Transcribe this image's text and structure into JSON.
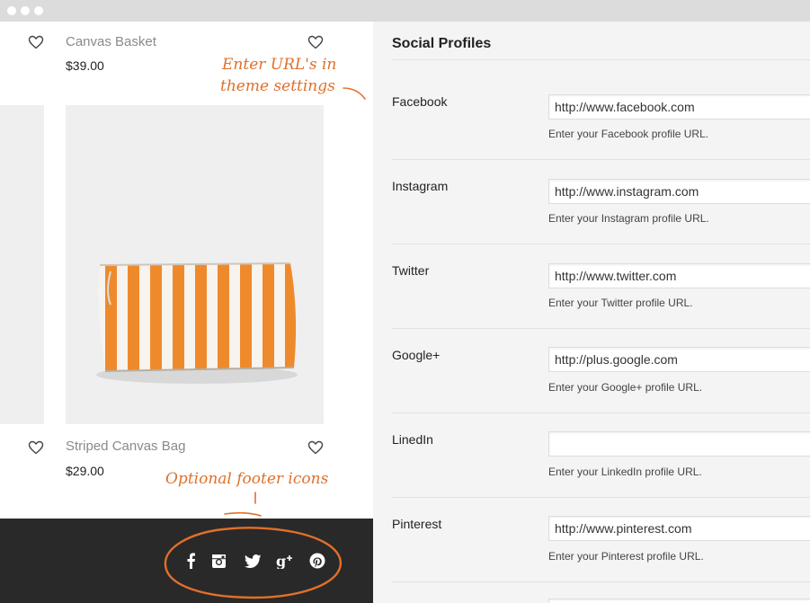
{
  "store": {
    "products": [
      {
        "name": "Canvas Basket",
        "price": "$39.00"
      },
      {
        "name": "Striped Canvas Bag",
        "price": "$29.00"
      }
    ],
    "annotations": {
      "theme_settings_line1": "Enter URL's in",
      "theme_settings_line2": "theme settings",
      "footer_icons": "Optional footer icons"
    },
    "footer_icons": [
      "facebook-icon",
      "instagram-icon",
      "twitter-icon",
      "google-plus-icon",
      "pinterest-icon"
    ]
  },
  "settings": {
    "title": "Social Profiles",
    "fields": [
      {
        "label": "Facebook",
        "value": "http://www.facebook.com",
        "description": "Enter your Facebook profile URL."
      },
      {
        "label": "Instagram",
        "value": "http://www.instagram.com",
        "description": "Enter your Instagram profile URL."
      },
      {
        "label": "Twitter",
        "value": "http://www.twitter.com",
        "description": "Enter your Twitter profile URL."
      },
      {
        "label": "Google+",
        "value": "http://plus.google.com",
        "description": "Enter your Google+ profile URL."
      },
      {
        "label": "LinedIn",
        "value": "",
        "description": "Enter your LinkedIn profile URL."
      },
      {
        "label": "Pinterest",
        "value": "http://www.pinterest.com",
        "description": "Enter your Pinterest profile URL."
      }
    ]
  },
  "colors": {
    "accent": "#e0702a",
    "footer_bg": "#292929",
    "settings_bg": "#f4f4f4",
    "bag_stripe": "#ef8a2c"
  }
}
